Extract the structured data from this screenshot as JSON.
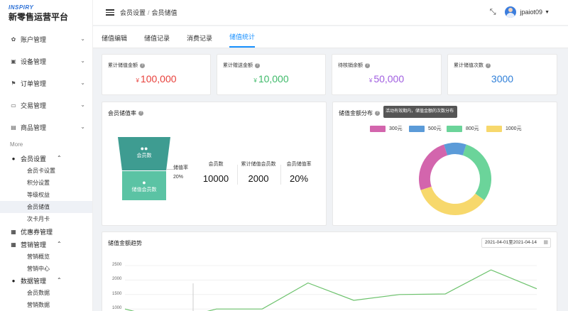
{
  "logo": {
    "brand": "INSPIRY",
    "name": "新零售运营平台"
  },
  "sidebar": {
    "top_items": [
      {
        "label": "账户管理",
        "icon": "gear-icon"
      },
      {
        "label": "设备管理",
        "icon": "box-icon"
      },
      {
        "label": "订单管理",
        "icon": "flag-icon"
      },
      {
        "label": "交易管理",
        "icon": "card-icon"
      },
      {
        "label": "商品管理",
        "icon": "shop-icon"
      }
    ],
    "more": "More",
    "member_group": {
      "label": "会员设置",
      "items": [
        "会员卡设置",
        "积分设置",
        "等级权益",
        "会员储值",
        "次卡月卡"
      ]
    },
    "coupon": "优惠券管理",
    "marketing_group": {
      "label": "营销管理",
      "items": [
        "营销概览",
        "营销中心"
      ]
    },
    "data_group": {
      "label": "数据管理",
      "items": [
        "会员数据",
        "营销数据"
      ]
    }
  },
  "header": {
    "breadcrumb": [
      "会员设置",
      "会员储值"
    ],
    "username": "jpaiot09"
  },
  "tabs": [
    "储值编辑",
    "储值记录",
    "消费记录",
    "储值统计"
  ],
  "stats": [
    {
      "title": "累计储值金额",
      "currency": "¥",
      "value": "100,000",
      "color": "#e8413c"
    },
    {
      "title": "累计赠送金额",
      "currency": "¥",
      "value": "10,000",
      "color": "#3fba6a"
    },
    {
      "title": "待核销余额",
      "currency": "¥",
      "value": "50,000",
      "color": "#a05ee0"
    },
    {
      "title": "累计储值次数",
      "currency": "",
      "value": "3000",
      "color": "#2f7fd8"
    }
  ],
  "funnel_panel": {
    "title": "会员储值率",
    "top_label": "会员数",
    "bottom_label": "储值会员数",
    "conv_label": "储值率",
    "conv_value": "20%",
    "metrics": [
      {
        "label": "会员数",
        "value": "10000"
      },
      {
        "label": "累计储值会员数",
        "value": "2000"
      },
      {
        "label": "会员储值率",
        "value": "20%"
      }
    ]
  },
  "donut_panel": {
    "title": "储值金额分布",
    "tooltip": "活动有效期内，储值金额的次数分布",
    "legend": [
      {
        "label": "300元",
        "color": "#d365ad",
        "value": 25
      },
      {
        "label": "500元",
        "color": "#5b9bd8",
        "value": 10
      },
      {
        "label": "800元",
        "color": "#6bd49a",
        "value": 30
      },
      {
        "label": "1000元",
        "color": "#f7d86c",
        "value": 35
      }
    ]
  },
  "trend_panel": {
    "title": "储值金额趋势",
    "date_range": "2021-04-01至2021-04-14",
    "y_ticks": [
      "2500",
      "2000",
      "1500",
      "1000"
    ]
  },
  "chart_data": {
    "type": "line",
    "ylim": [
      0,
      2500
    ],
    "series": [
      {
        "color": "#6cc26c",
        "values": [
          1000,
          600,
          1000,
          1000,
          1900,
          1300,
          1500,
          1520,
          2350,
          1700
        ]
      }
    ]
  },
  "colors": {
    "accent": "#1890ff"
  }
}
